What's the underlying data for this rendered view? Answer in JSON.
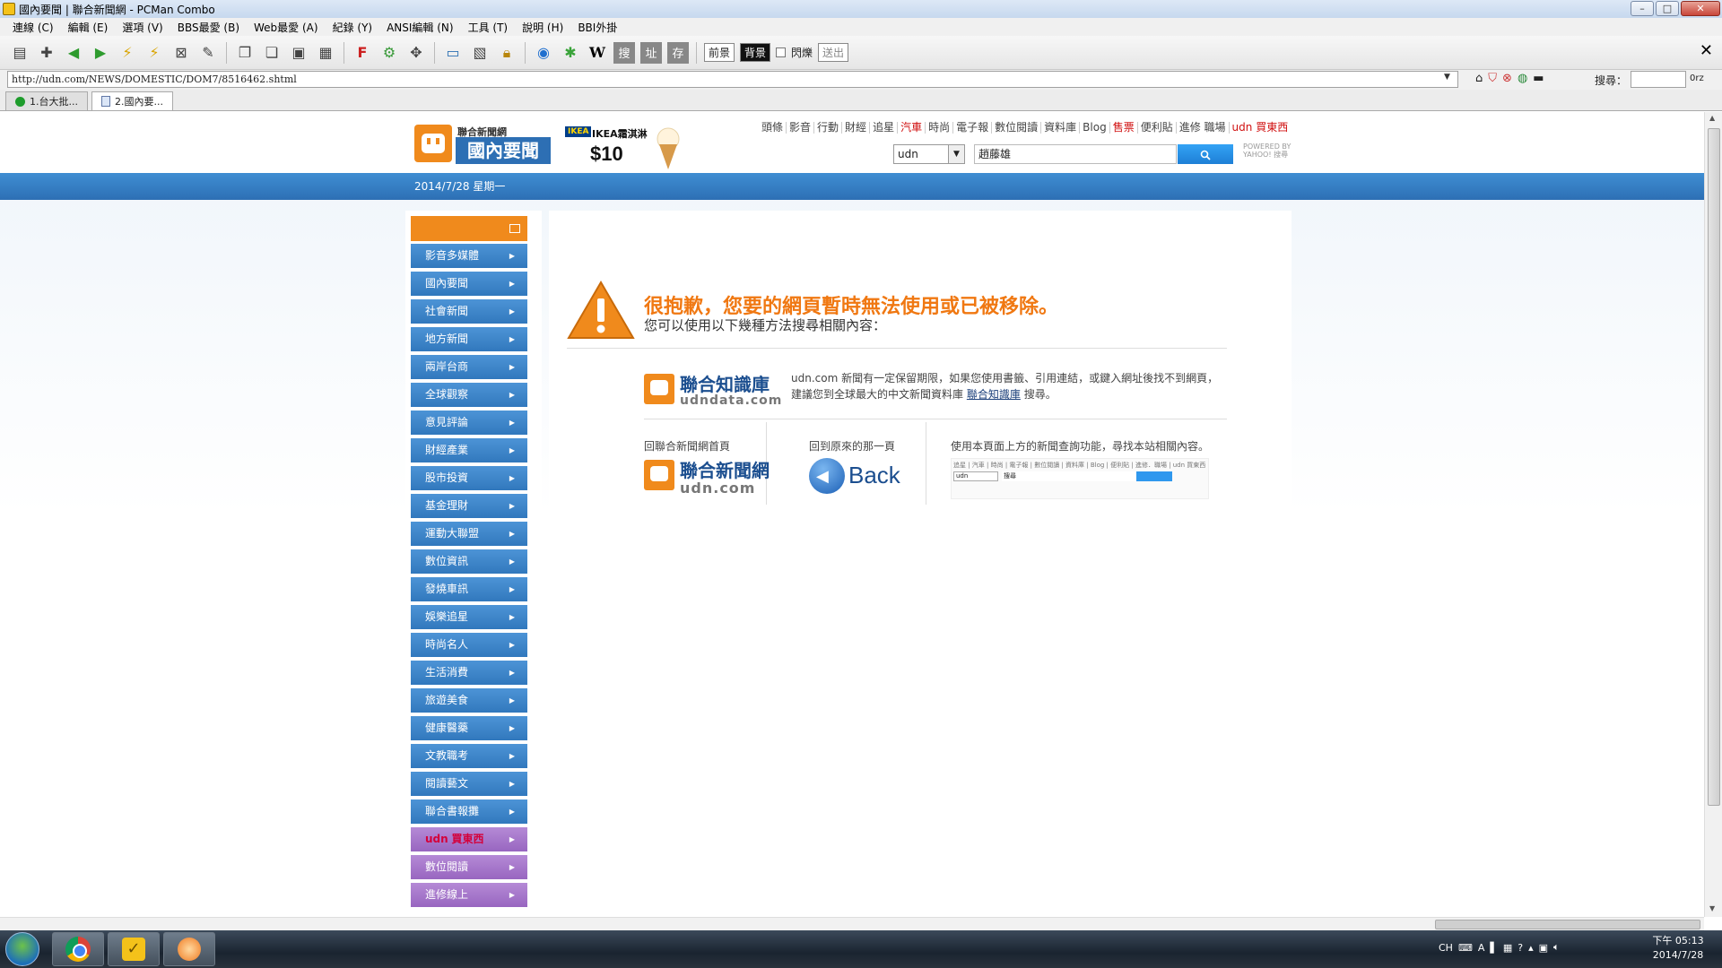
{
  "window": {
    "title": "國內要聞 | 聯合新聞網 - PCMan Combo",
    "controls": {
      "minimize": "–",
      "maximize": "□",
      "close": "✕"
    }
  },
  "menubar": [
    "連線 (C)",
    "編輯 (E)",
    "選項 (V)",
    "BBS最愛 (B)",
    "Web最愛 (A)",
    "紀錄 (Y)",
    "ANSI編輯 (N)",
    "工具 (T)",
    "說明 (H)",
    "BBI外掛"
  ],
  "toolbar": {
    "front_label": "前景",
    "back_label": "背景",
    "blink_label": "閃爍",
    "send_label": "送出",
    "wiki_label": "W",
    "search_label": "搜",
    "addr_label": "址",
    "save_label": "存",
    "close_label": "✕"
  },
  "address": {
    "url": "http://udn.com/NEWS/DOMESTIC/DOM7/8516462.shtml",
    "search_label": "搜尋：",
    "search_value": "",
    "engine": "0rz"
  },
  "tabs": [
    {
      "label": "1.台大批..."
    },
    {
      "label": "2.國內要..."
    }
  ],
  "header": {
    "logo_small": "聯合新聞網",
    "logo_big": "國內要聞",
    "date": "2014/7/28 星期一",
    "ad": {
      "brand": "IKEA",
      "title": "IKEA霜淇淋",
      "price": "$10"
    },
    "nav": [
      {
        "label": "頭條",
        "red": false
      },
      {
        "label": "影音",
        "red": false
      },
      {
        "label": "行動",
        "red": false
      },
      {
        "label": "財經",
        "red": false
      },
      {
        "label": "追星",
        "red": false
      },
      {
        "label": "汽車",
        "red": true
      },
      {
        "label": "時尚",
        "red": false
      },
      {
        "label": "電子報",
        "red": false
      },
      {
        "label": "數位閱讀",
        "red": false
      },
      {
        "label": "資料庫",
        "red": false
      },
      {
        "label": "Blog",
        "red": false
      },
      {
        "label": "售票",
        "red": true
      },
      {
        "label": "便利貼",
        "red": false
      },
      {
        "label": "進修 職場",
        "red": false
      },
      {
        "label": "udn 買東西",
        "red": true
      }
    ],
    "search": {
      "site": "udn",
      "query": "趙藤雄",
      "button_icon": "search-icon",
      "powered": "POWERED BY YAHOO! 搜尋"
    }
  },
  "sidebar": {
    "items": [
      {
        "label": "影音多媒體"
      },
      {
        "label": "國內要聞"
      },
      {
        "label": "社會新聞"
      },
      {
        "label": "地方新聞"
      },
      {
        "label": "兩岸台商"
      },
      {
        "label": "全球觀察"
      },
      {
        "label": "意見評論"
      },
      {
        "label": "財經產業"
      },
      {
        "label": "股市投資"
      },
      {
        "label": "基金理財"
      },
      {
        "label": "運動大聯盟"
      },
      {
        "label": "數位資訊"
      },
      {
        "label": "發燒車訊"
      },
      {
        "label": "娛樂追星"
      },
      {
        "label": "時尚名人"
      },
      {
        "label": "生活消費"
      },
      {
        "label": "旅遊美食"
      },
      {
        "label": "健康醫藥"
      },
      {
        "label": "文教職考"
      },
      {
        "label": "閱讀藝文"
      },
      {
        "label": "聯合書報攤"
      }
    ],
    "violet_items": [
      {
        "prefix": "udn",
        "label": "買東西"
      },
      {
        "prefix": "",
        "label": "數位閱讀"
      },
      {
        "prefix": "",
        "label": "進修線上"
      }
    ]
  },
  "content": {
    "error_title": "很抱歉，您要的網頁暫時無法使用或已被移除。",
    "error_sub": "您可以使用以下幾種方法搜尋相關內容：",
    "udndata": {
      "logo_cn": "聯合知識庫",
      "logo_en": "udndata.com",
      "desc_1": "udn.com 新聞有一定保留期限，如果您使用書籤、引用連結，或鍵入網址後找不到網頁，",
      "desc_2": "建議您到全球最大的中文新聞資料庫",
      "desc_link": "聯合知識庫",
      "desc_3": "搜尋。"
    },
    "col1_title": "回聯合新聞網首頁",
    "col1_logo_cn": "聯合新聞網",
    "col1_logo_en": "udn.com",
    "col2_title": "回到原來的那一頁",
    "col2_back": "Back",
    "col3_title": "使用本頁面上方的新聞查詢功能，尋找本站相關內容。",
    "mini": {
      "nav": "追星 | 汽車 | 時尚 | 電子報 | 數位閱讀 | 資料庫 | Blog | 便利貼 | 進修．職場 | udn 買東西",
      "select": "udn",
      "query": "搜尋"
    }
  },
  "taskbar": {
    "tray": [
      "CH"
    ],
    "time": "下午 05:13",
    "date": "2014/7/28"
  }
}
